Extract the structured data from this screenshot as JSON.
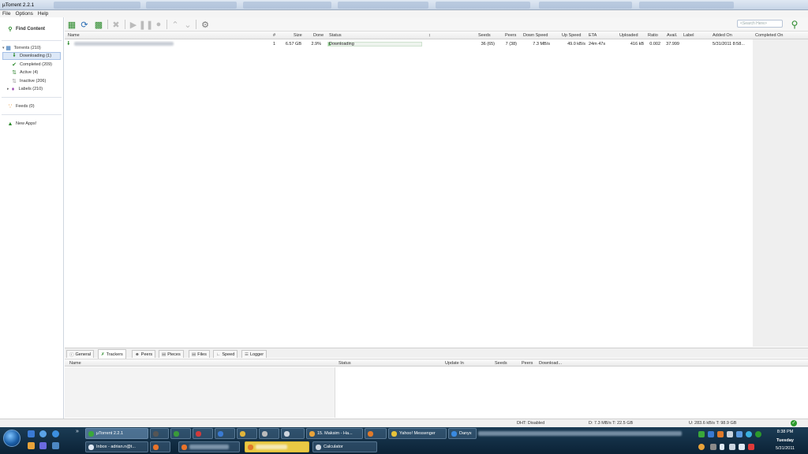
{
  "window": {
    "title": "µTorrent 2.2.1"
  },
  "menu": [
    "File",
    "Options",
    "Help"
  ],
  "search": {
    "placeholder": "<Search Here>"
  },
  "sidebar": {
    "find_content": "Find Content",
    "items": [
      {
        "label": "Torrents (210)",
        "icon": "torrents-icon"
      },
      {
        "label": "Downloading (1)",
        "icon": "download-arrow-icon",
        "selected": true
      },
      {
        "label": "Completed (209)",
        "icon": "checkmark-icon"
      },
      {
        "label": "Active (4)",
        "icon": "active-arrows-icon"
      },
      {
        "label": "Inactive (206)",
        "icon": "inactive-icon"
      },
      {
        "label": "Labels (210)",
        "icon": "label-tag-icon"
      }
    ],
    "feeds": "Feeds (0)",
    "new_apps": "New Apps!"
  },
  "list": {
    "columns": [
      "Name",
      "#",
      "Size",
      "Done",
      "Status",
      "↕",
      "Seeds",
      "Peers",
      "Down Speed",
      "Up Speed",
      "ETA",
      "Uploaded",
      "Ratio",
      "Avail.",
      "Label",
      "Added On",
      "Completed On"
    ],
    "rows": [
      {
        "num": "1",
        "size": "6.57 GB",
        "done": "2.9%",
        "status": "Downloading",
        "seeds": "36 (65)",
        "peers": "7 (38)",
        "down": "7.3 MB/s",
        "up": "49.0 kB/s",
        "eta": "24m 47s",
        "uploaded": "416 kB",
        "ratio": "0.002",
        "avail": "37.999",
        "label": "",
        "added": "5/31/2011 8:58...",
        "completed": "",
        "progress": 0.029
      }
    ]
  },
  "detail_tabs": [
    "General",
    "Trackers",
    "Peers",
    "Pieces",
    "Files",
    "Speed",
    "Logger"
  ],
  "detail_active": "Trackers",
  "tracker_columns": [
    "Name",
    "Status",
    "Update In",
    "Seeds",
    "Peers",
    "Download..."
  ],
  "statusbar": {
    "dht": "DHT: Disabled",
    "down": "D: 7.3 MB/s T: 22.5 GB",
    "up": "U: 283.6 kB/s T: 98.9 GB"
  },
  "taskbar": {
    "top_row": [
      "µTorrent 2.2.1",
      "15. Maksim - Ha...",
      "Yahoo! Messenger",
      "Danyx"
    ],
    "bottom_row": [
      "Inbox - adrian.n@t...",
      "Calculator"
    ],
    "clock": {
      "time": "8:38 PM",
      "day": "Tuesday",
      "date": "5/31/2011"
    }
  },
  "colors": {
    "accent": "#2f8a2f",
    "selection": "#dde8f7",
    "taskbar": "#0b2236",
    "highlight": "#e9c944"
  }
}
